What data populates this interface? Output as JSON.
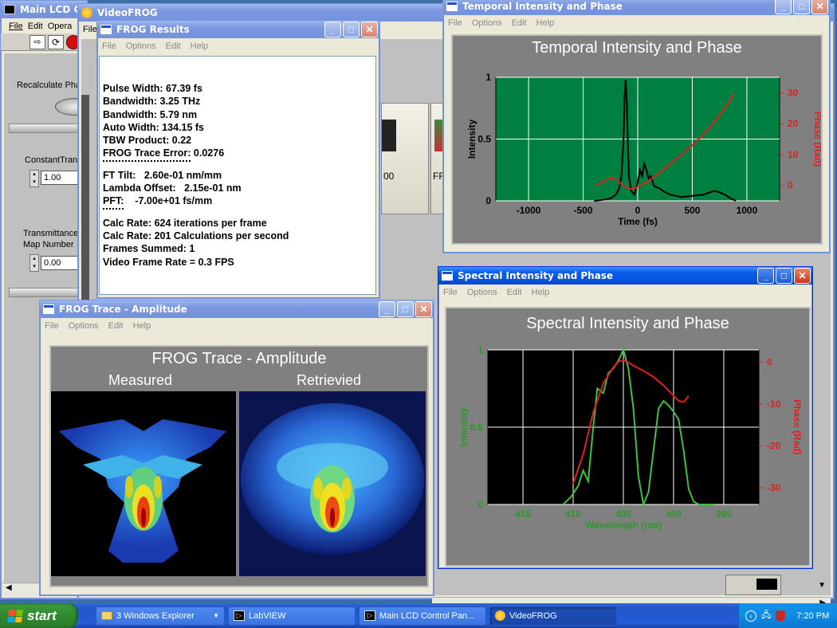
{
  "main_lcd": {
    "title": "Main LCD C",
    "menu": [
      "File",
      "Edit",
      "Opera"
    ],
    "recalculate_label": "Recalculate Pha",
    "constant_label": "ConstantTran",
    "constant_value": "1.00",
    "transmittance_label": "Transmittance",
    "map_number_label": "Map Number",
    "map_value": "0.00"
  },
  "videofrog": {
    "title": "VideoFROG",
    "menu_first": "File",
    "thumb_label_1": "00",
    "thumb_label_2": "FR"
  },
  "frog_results": {
    "title": "FROG Results",
    "menu": [
      "File",
      "Options",
      "Edit",
      "Help"
    ],
    "lines_group1": [
      "Pulse Width: 67.39 fs",
      "Bandwidth: 3.25 THz",
      "Bandwidth: 5.79 nm",
      "Auto Width: 134.15 fs",
      "TBW Product: 0.22",
      "FROG Trace Error: 0.0276"
    ],
    "lines_group2": [
      "FT Tilt:   2.60e-01 nm/mm",
      "Lambda Offset:   2.15e-01 nm",
      "PFT:    -7.00e+01 fs/mm"
    ],
    "lines_group3": [
      "Calc Rate: 624 iterations per frame",
      "Calc Rate: 201 Calculations per second",
      "Frames Summed: 1",
      "Video Frame Rate = 0.3 FPS"
    ]
  },
  "temporal": {
    "window_title": "Temporal Intensity and Phase",
    "menu": [
      "File",
      "Options",
      "Edit",
      "Help"
    ],
    "plot_title": "Temporal Intensity and Phase",
    "xlabel": "Time (fs)",
    "ylabel": "Intensity",
    "y2label": "Phase (Rad)",
    "xticks": [
      "-1000",
      "-500",
      "0",
      "500",
      "1000"
    ],
    "yticks": [
      "0",
      "0.5",
      "1"
    ],
    "y2ticks": [
      "0",
      "10",
      "20",
      "30"
    ]
  },
  "spectral": {
    "window_title": "Spectral Intensity and Phase",
    "menu": [
      "File",
      "Options",
      "Edit",
      "Help"
    ],
    "plot_title": "Spectral Intensity and Phase",
    "xlabel": "Wavelength (nm)",
    "ylabel": "Intensity",
    "y2label": "Phase (Rad)",
    "xticks": [
      "415",
      "410",
      "405",
      "400",
      "395"
    ],
    "yticks": [
      "0",
      "0.5",
      "1"
    ],
    "y2ticks": [
      "0",
      "-10",
      "-20",
      "-30"
    ]
  },
  "frog_trace": {
    "window_title": "FROG Trace - Amplitude",
    "menu": [
      "File",
      "Options",
      "Edit",
      "Help"
    ],
    "plot_title": "FROG Trace - Amplitude",
    "measured_label": "Measured",
    "retrieved_label": "Retrievied"
  },
  "taskbar": {
    "start_label": "start",
    "items": [
      "3 Windows Explorer",
      "LabVIEW",
      "Main LCD Control Pan...",
      "VideoFROG"
    ],
    "clock": "7:20 PM"
  },
  "colors": {
    "plot_green_bg": "#008040",
    "temporal_intensity": "#000000",
    "temporal_phase": "#e02020",
    "spectral_intensity": "#40c040",
    "spectral_phase": "#e02020",
    "phase_axis": "#e02020"
  },
  "chart_data": [
    {
      "type": "line",
      "title": "Temporal Intensity and Phase",
      "xlabel": "Time (fs)",
      "ylabel": "Intensity",
      "y2label": "Phase (Rad)",
      "xlim": [
        -1300,
        1300
      ],
      "ylim": [
        0,
        1
      ],
      "y2lim": [
        -5,
        35
      ],
      "grid": true,
      "series": [
        {
          "name": "Intensity",
          "axis": "y",
          "x": [
            -400,
            -300,
            -250,
            -200,
            -170,
            -150,
            -130,
            -120,
            -110,
            -100,
            -90,
            -80,
            -60,
            -30,
            0,
            20,
            40,
            60,
            80,
            100,
            120,
            150,
            200,
            250,
            300,
            400,
            500,
            600,
            700,
            750,
            800,
            850,
            900
          ],
          "y": [
            0.0,
            0.01,
            0.02,
            0.05,
            0.1,
            0.2,
            0.5,
            0.85,
            0.98,
            0.8,
            0.45,
            0.2,
            0.08,
            0.05,
            0.15,
            0.25,
            0.2,
            0.3,
            0.25,
            0.18,
            0.2,
            0.12,
            0.1,
            0.07,
            0.05,
            0.03,
            0.04,
            0.05,
            0.08,
            0.07,
            0.05,
            0.02,
            0.0
          ]
        },
        {
          "name": "Phase",
          "axis": "y2",
          "x": [
            -380,
            -300,
            -250,
            -200,
            -150,
            -100,
            -50,
            0,
            100,
            200,
            300,
            400,
            500,
            600,
            700,
            800,
            880
          ],
          "y": [
            0.0,
            1.5,
            2.5,
            2.0,
            0.5,
            -0.8,
            -1.2,
            -0.5,
            1.5,
            4.0,
            7.0,
            10.0,
            13.0,
            16.5,
            20.5,
            25.0,
            29.5
          ]
        }
      ]
    },
    {
      "type": "line",
      "title": "Spectral Intensity and Phase",
      "xlabel": "Wavelength (nm)",
      "ylabel": "Intensity",
      "y2label": "Phase (Rad)",
      "xlim": [
        418.5,
        391.5
      ],
      "ylim": [
        0,
        1
      ],
      "y2lim": [
        -34,
        3
      ],
      "grid": true,
      "series": [
        {
          "name": "Intensity",
          "axis": "y",
          "x": [
            411,
            410.2,
            409.5,
            409,
            408.5,
            408,
            407.6,
            407,
            406.5,
            406,
            405.5,
            405,
            404.5,
            404,
            403.5,
            403,
            402.5,
            402,
            401.5,
            401,
            400.5,
            400,
            399.5,
            399,
            398.5,
            398,
            397.5,
            396
          ],
          "y": [
            0,
            0.05,
            0.12,
            0.22,
            0.15,
            0.5,
            0.75,
            0.72,
            0.85,
            0.88,
            0.93,
            1.0,
            0.88,
            0.62,
            0.18,
            0.0,
            0.08,
            0.35,
            0.62,
            0.67,
            0.64,
            0.6,
            0.55,
            0.35,
            0.1,
            0.02,
            0.0,
            0.0
          ]
        },
        {
          "name": "Phase",
          "axis": "y2",
          "x": [
            410,
            409,
            408.5,
            408,
            407,
            406,
            405.5,
            405,
            404.5,
            404,
            403,
            402,
            401,
            400,
            399.5,
            399,
            398.5
          ],
          "y": [
            -29,
            -22,
            -17,
            -12,
            -5,
            -1.2,
            0.2,
            0.5,
            0,
            -0.8,
            -2,
            -3.5,
            -5.5,
            -8,
            -9.2,
            -9.5,
            -8
          ]
        }
      ]
    }
  ]
}
